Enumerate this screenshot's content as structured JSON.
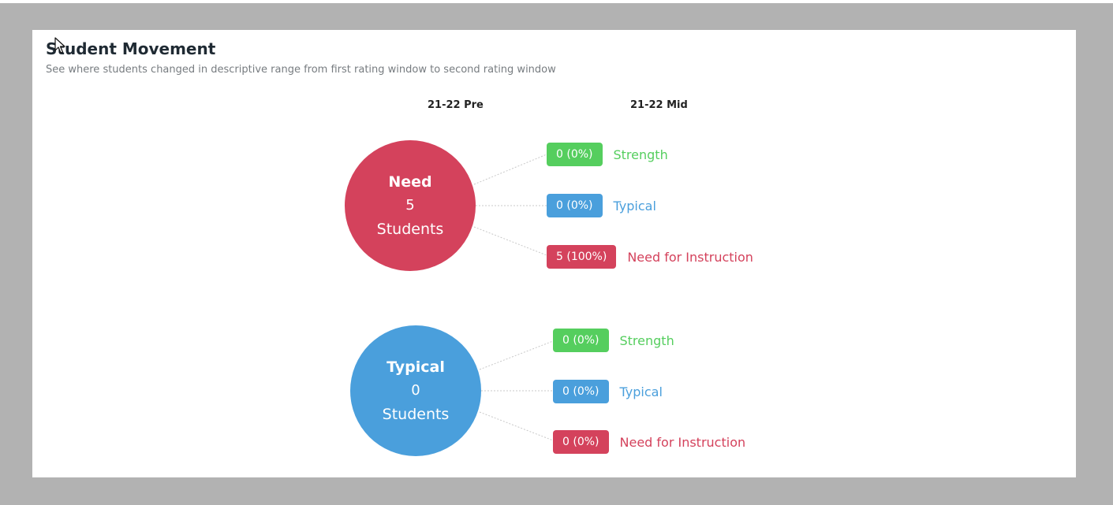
{
  "header": {
    "title": "Student Movement",
    "subtitle": "See where students changed in descriptive range from first rating window to second rating window"
  },
  "columns": {
    "pre": "21-22 Pre",
    "mid": "21-22 Mid"
  },
  "groups": [
    {
      "name": "Need",
      "count": "5",
      "unit": "Students",
      "color": "#d4425c",
      "outcomes": [
        {
          "value": "0 (0%)",
          "label": "Strength",
          "color": "#55ce5e"
        },
        {
          "value": "0 (0%)",
          "label": "Typical",
          "color": "#4a9fdc"
        },
        {
          "value": "5 (100%)",
          "label": "Need for Instruction",
          "color": "#d4425c"
        }
      ]
    },
    {
      "name": "Typical",
      "count": "0",
      "unit": "Students",
      "color": "#4a9fdc",
      "outcomes": [
        {
          "value": "0 (0%)",
          "label": "Strength",
          "color": "#55ce5e"
        },
        {
          "value": "0 (0%)",
          "label": "Typical",
          "color": "#4a9fdc"
        },
        {
          "value": "0 (0%)",
          "label": "Need for Instruction",
          "color": "#d4425c"
        }
      ]
    }
  ],
  "icons": {
    "cursor": "mouse-pointer-icon"
  }
}
